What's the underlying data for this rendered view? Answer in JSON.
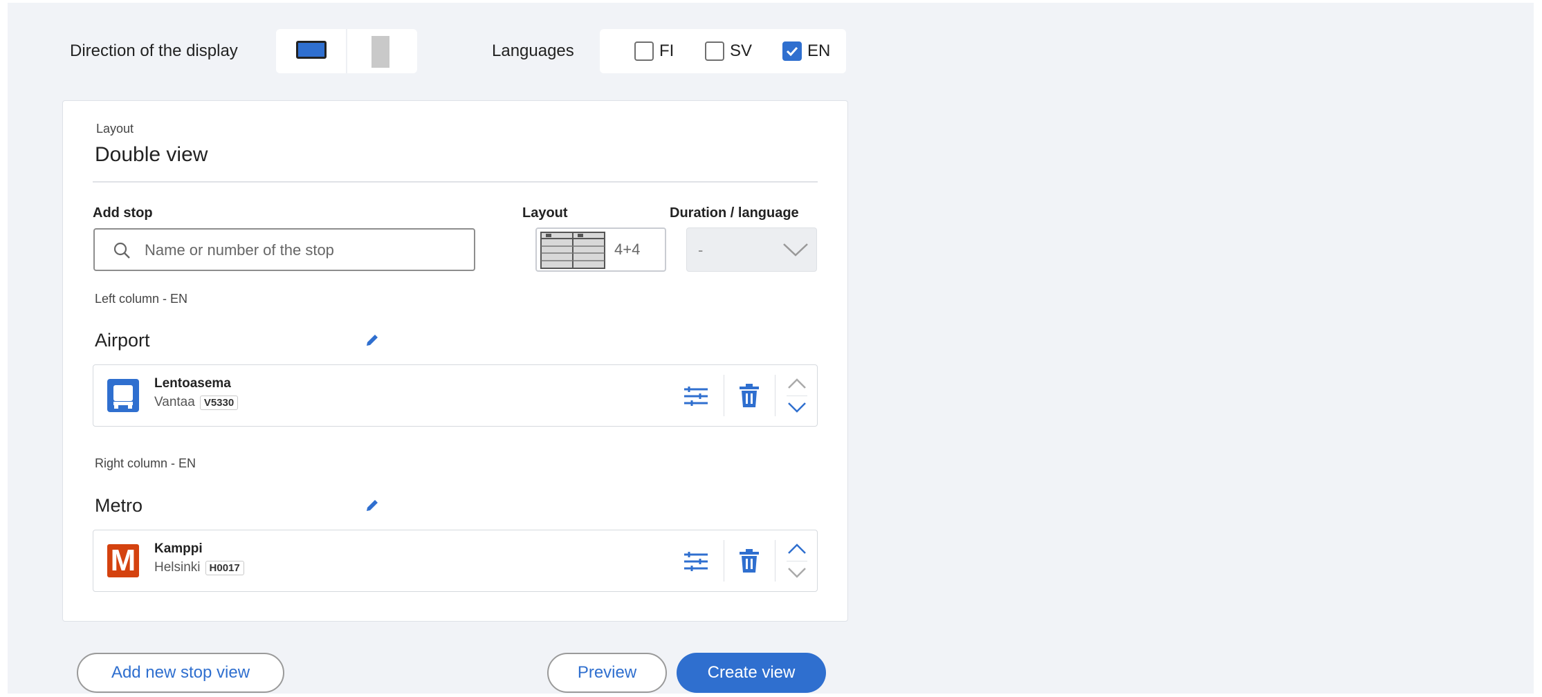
{
  "top_bar": {
    "direction_label": "Direction of the display",
    "languages_label": "Languages",
    "languages": [
      {
        "code": "FI",
        "checked": false
      },
      {
        "code": "SV",
        "checked": false
      },
      {
        "code": "EN",
        "checked": true
      }
    ]
  },
  "card": {
    "layout_caption": "Layout",
    "layout_title": "Double view",
    "add_stop_label": "Add stop",
    "search_placeholder": "Name or number of the stop",
    "layout_label": "Layout",
    "layout_value": "4+4",
    "duration_label": "Duration / language",
    "duration_value": "-",
    "columns": [
      {
        "caption": "Left column - EN",
        "title": "Airport",
        "stop": {
          "name": "Lentoasema",
          "city": "Vantaa",
          "code": "V5330",
          "mode": "bus"
        }
      },
      {
        "caption": "Right column - EN",
        "title": "Metro",
        "stop": {
          "name": "Kamppi",
          "city": "Helsinki",
          "code": "H0017",
          "mode": "metro",
          "metro_letter": "M"
        }
      }
    ]
  },
  "buttons": {
    "add_new": "Add new stop view",
    "preview": "Preview",
    "create": "Create view"
  },
  "colors": {
    "accent": "#2f6fcf",
    "bus": "#2f6fcf",
    "metro": "#d4420f",
    "background": "#f1f3f7"
  }
}
